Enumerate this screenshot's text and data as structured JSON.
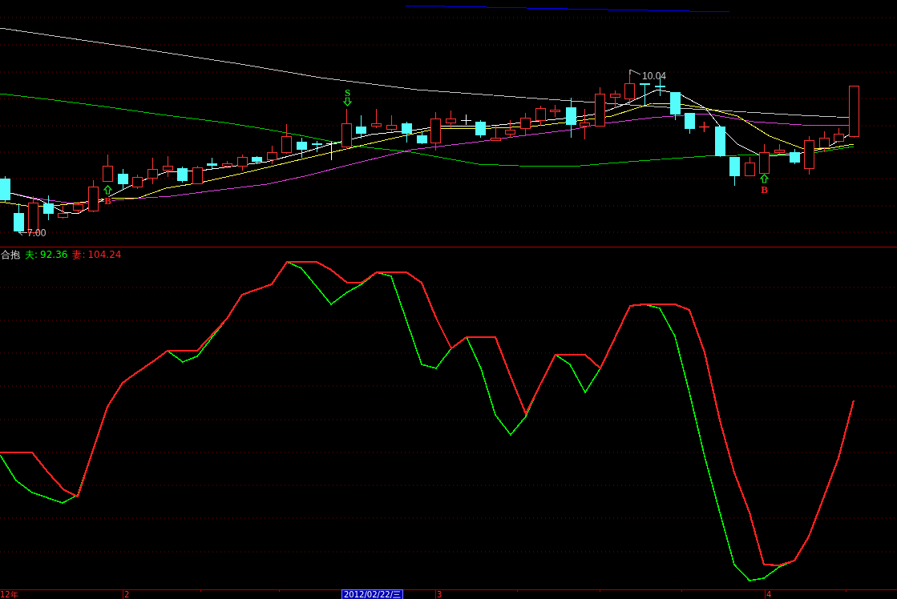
{
  "price_chart": {
    "high_label": "10.04",
    "low_label": "7.00",
    "signals": [
      {
        "kind": "buy",
        "label": "B"
      },
      {
        "kind": "sell",
        "label": "S"
      },
      {
        "kind": "buy",
        "label": "B"
      }
    ]
  },
  "indicator": {
    "name": "合抱",
    "series": [
      {
        "label": "夫:",
        "value": "92.36",
        "color": "#00ff00"
      },
      {
        "label": "妻:",
        "value": "104.24",
        "color": "#ff2020"
      }
    ]
  },
  "time_axis": {
    "labels": [
      {
        "text": "12年",
        "kind": "tick"
      },
      {
        "text": "2",
        "kind": "tick"
      },
      {
        "text": "2012/02/22/三",
        "kind": "cursor"
      },
      {
        "text": "3",
        "kind": "tick"
      },
      {
        "text": "4",
        "kind": "tick"
      }
    ]
  }
}
